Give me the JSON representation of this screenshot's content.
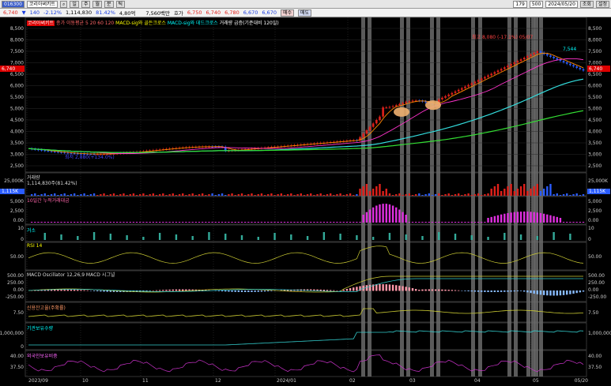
{
  "toolbar": {
    "code": "016300",
    "name": "코리아써키트",
    "period_count": "179",
    "unit": "500",
    "date": "2024/05/20",
    "btn_view": "조회",
    "btn_opt": "설정"
  },
  "quote": {
    "price": "6,740",
    "change_sym": "▼",
    "change": "140",
    "change_pct": "-2.12%",
    "volume": "1,114,830",
    "vol_ratio": "81.42%",
    "amount": "4,80억",
    "amount_label": "7,560백만",
    "prev_label": "호가",
    "open": "6,750",
    "high": "6,740",
    "low": "6,780",
    "close": "6,670",
    "ref": "6,670",
    "btn_a": "매수",
    "btn_b": "매도"
  },
  "price_panel": {
    "legend": [
      "코리아써키트",
      "종가 이동평균 5 20 60 120",
      "MACD-sig와 골든크로스",
      "MACD-sig와 데드크로스",
      "거래량 급증(기준대비 120일)"
    ],
    "hi_label": "최고 8,080 (-17.1%) 05/07",
    "lo_label": "최저 2,880(+134.0%)",
    "ma_label": "7,544",
    "y_ticks": [
      "8,500",
      "8,000",
      "7,500",
      "7,000",
      "6,500",
      "6,000",
      "5,500",
      "5,000",
      "4,500",
      "4,000",
      "3,500",
      "3,000",
      "2,500"
    ],
    "current_price": "6,740"
  },
  "volume_panel": {
    "title": "거래량",
    "value": "1,114,830주(81.42%)",
    "tick": "25,000K",
    "last": "1,115K"
  },
  "ratio_panel": {
    "title": "10일간 누적거래대금",
    "ticks": [
      "5,000",
      "2,500",
      "0.00"
    ]
  },
  "sub_panel": {
    "title": "거소",
    "ticks": [
      "10",
      "0"
    ]
  },
  "rsi_panel": {
    "title": "RSI 14",
    "ticks": [
      "50.00"
    ]
  },
  "macd_panel": {
    "title": "MACD Oscillator 12,26,9  MACD  시그널",
    "ticks": [
      "500.00",
      "250.00",
      "0.00",
      "-250.00"
    ]
  },
  "credit_panel": {
    "title": "신용잔고율(주확률)",
    "ticks": [
      "7.50"
    ]
  },
  "inst_panel": {
    "title": "기관보유수량",
    "ticks": [
      "1,000,000",
      "0"
    ]
  },
  "foreign_panel": {
    "title": "외국인보유비중",
    "ticks": [
      "40.00",
      "37.50"
    ]
  },
  "x_axis": [
    "2023/09",
    "10",
    "11",
    "12",
    "2024/01",
    "02",
    "03",
    "04",
    "05",
    "05/20"
  ],
  "colors": {
    "up": "#e0201a",
    "down": "#2a5cff",
    "ma5": "#ff8800",
    "ma20": "#ff33cc",
    "ma60": "#33dddd",
    "ma120": "#33dd33"
  }
}
